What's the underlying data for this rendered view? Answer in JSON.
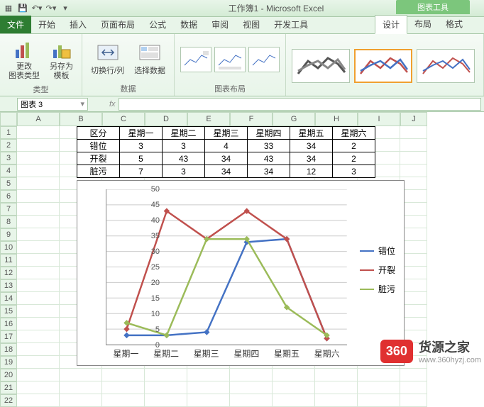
{
  "window": {
    "title": "工作簿1 - Microsoft Excel",
    "context_group": "图表工具"
  },
  "tabs": {
    "file": "文件",
    "items": [
      "开始",
      "插入",
      "页面布局",
      "公式",
      "数据",
      "审阅",
      "视图",
      "开发工具"
    ],
    "context_items": [
      "设计",
      "布局",
      "格式"
    ],
    "active": "设计"
  },
  "ribbon": {
    "group1": {
      "label": "类型",
      "change_type": "更改\n图表类型",
      "save_template": "另存为\n模板"
    },
    "group2": {
      "label": "数据",
      "switch": "切换行/列",
      "select": "选择数据"
    },
    "group3": {
      "label": "图表布局"
    }
  },
  "name_box": "图表 3",
  "columns": [
    "A",
    "B",
    "C",
    "D",
    "E",
    "F",
    "G",
    "H",
    "I",
    "J"
  ],
  "rows": [
    "1",
    "2",
    "3",
    "4",
    "5",
    "6",
    "7",
    "8",
    "9",
    "10",
    "11",
    "12",
    "13",
    "14",
    "15",
    "16",
    "17",
    "18",
    "19",
    "20",
    "21",
    "22"
  ],
  "table": {
    "header": [
      "区分",
      "星期一",
      "星期二",
      "星期三",
      "星期四",
      "星期五",
      "星期六"
    ],
    "rows": [
      [
        "错位",
        "3",
        "3",
        "4",
        "33",
        "34",
        "2"
      ],
      [
        "开裂",
        "5",
        "43",
        "34",
        "43",
        "34",
        "2"
      ],
      [
        "脏污",
        "7",
        "3",
        "34",
        "34",
        "12",
        "3"
      ]
    ]
  },
  "chart_data": {
    "type": "line",
    "categories": [
      "星期一",
      "星期二",
      "星期三",
      "星期四",
      "星期五",
      "星期六"
    ],
    "series": [
      {
        "name": "错位",
        "values": [
          3,
          3,
          4,
          33,
          34,
          2
        ],
        "color": "#4472c4"
      },
      {
        "name": "开裂",
        "values": [
          5,
          43,
          34,
          43,
          34,
          2
        ],
        "color": "#c0504d"
      },
      {
        "name": "脏污",
        "values": [
          7,
          3,
          34,
          34,
          12,
          3
        ],
        "color": "#9bbb59"
      }
    ],
    "ylim": [
      0,
      50
    ],
    "yticks": [
      0,
      5,
      10,
      15,
      20,
      25,
      30,
      35,
      40,
      45,
      50
    ],
    "xlabel": "",
    "ylabel": "",
    "title": ""
  },
  "watermark": {
    "badge": "360",
    "title": "货源之家",
    "url": "www.360hyzj.com"
  }
}
